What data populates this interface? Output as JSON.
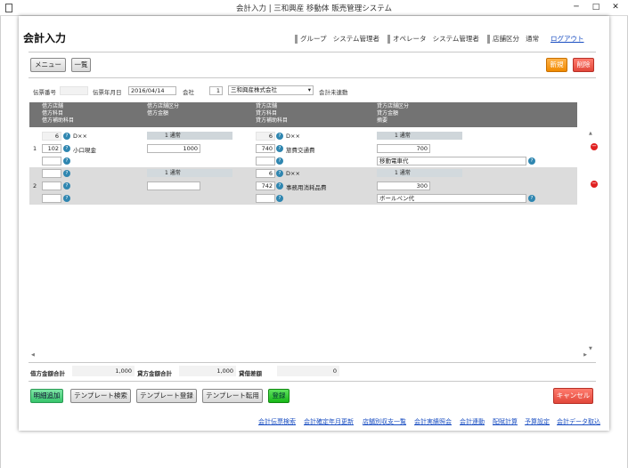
{
  "window": {
    "title": "会計入力 | 三和興産 移動体 販売管理システム",
    "minimize": "─",
    "maximize": "□",
    "close": "✕"
  },
  "header": {
    "page_title": "会計入力",
    "group_label": "グループ",
    "group_value": "システム管理者",
    "operator_label": "オペレータ",
    "operator_value": "システム管理者",
    "store_label": "店舗区分",
    "store_value": "通常",
    "logout": "ログアウト"
  },
  "toolbar": {
    "menu": "メニュー",
    "list": "一覧",
    "new": "新規",
    "delete": "削除"
  },
  "slip": {
    "slip_no_label": "伝票番号",
    "slip_no_value": "",
    "date_label": "伝票年月日",
    "date_value": "2016/04/14",
    "company_label": "会社",
    "company_code": "1",
    "company_name": "三和興産株式会社",
    "status": "会計未連動"
  },
  "columns": {
    "debit": [
      "借方店舗",
      "借方科目",
      "借方補助科目"
    ],
    "debit_cls": [
      "借方店舗区分",
      "借方金額"
    ],
    "credit": [
      "貸方店舗",
      "貸方科目",
      "貸方補助科目"
    ],
    "credit_cls": [
      "貸方店舗区分",
      "貸方金額",
      "摘要"
    ]
  },
  "rows": [
    {
      "no": "1",
      "debit_store_code": "6",
      "debit_store_name": "D××",
      "debit_account_code": "102",
      "debit_account_name": "小口現金",
      "debit_sub": "",
      "debit_cls": "1 通常",
      "debit_amount": "1000",
      "credit_store_code": "6",
      "credit_store_name": "D××",
      "credit_account_code": "740",
      "credit_account_name": "旅費交通費",
      "credit_sub": "",
      "credit_cls": "1 通常",
      "credit_amount": "700",
      "memo": "移動電車代",
      "delete_icon": "−"
    },
    {
      "no": "2",
      "debit_store_code": "",
      "debit_store_name": "",
      "debit_account_code": "",
      "debit_account_name": "",
      "debit_sub": "",
      "debit_cls": "1 通常",
      "debit_amount": "",
      "credit_store_code": "6",
      "credit_store_name": "D××",
      "credit_account_code": "742",
      "credit_account_name": "事務用消耗品費",
      "credit_sub": "",
      "credit_cls": "1 通常",
      "credit_amount": "300",
      "memo": "ボールペン代",
      "delete_icon": "−"
    }
  ],
  "totals": {
    "debit_label": "借方金額合計",
    "debit_value": "1,000",
    "credit_label": "貸方金額合計",
    "credit_value": "1,000",
    "diff_label": "貸借差額",
    "diff_value": "0"
  },
  "actions": {
    "add_line": "明細追加",
    "tpl_search": "テンプレート検索",
    "tpl_register": "テンプレート登録",
    "tpl_apply": "テンプレート転用",
    "register": "登録",
    "cancel": "キャンセル"
  },
  "footer_links": [
    "会計伝票検索",
    "会計確定年月更新",
    "店舗別収支一覧",
    "会計実績照会",
    "会計連動",
    "配賦計算",
    "予算設定",
    "会計データ取込"
  ],
  "icons": {
    "lookup": "?",
    "scroll_up": "▲",
    "scroll_down": "▼",
    "scroll_left": "◀",
    "scroll_right": "▶"
  }
}
